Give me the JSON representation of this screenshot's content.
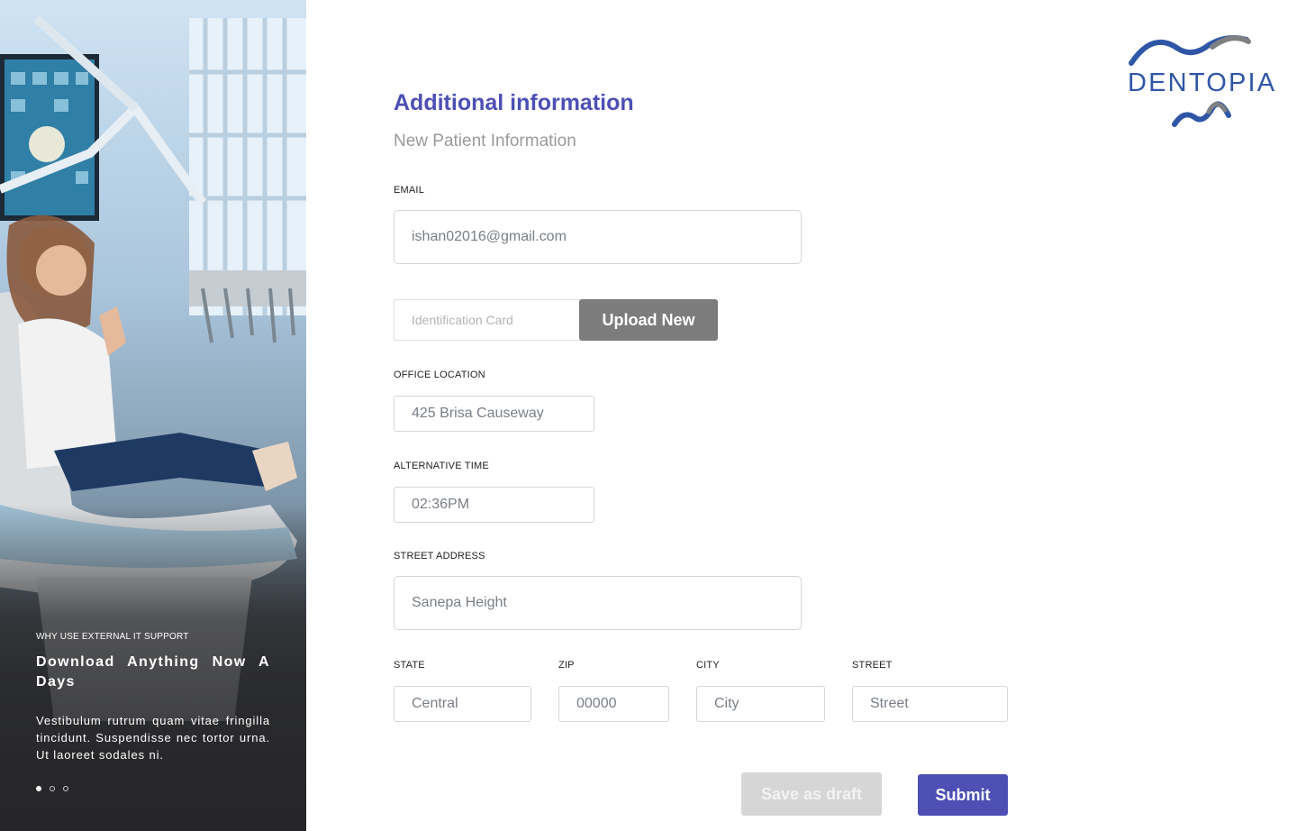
{
  "brand": {
    "name": "DENTOPIA",
    "primary_color": "#4d4fb5",
    "logo_color": "#2f56a6"
  },
  "hero": {
    "kicker": "WHY USE EXTERNAL IT SUPPORT",
    "title": "Download Anything Now A Days",
    "text": "Vestibulum rutrum quam vitae fringilla tincidunt. Suspendisse nec tortor urna. Ut laoreet sodales ni.",
    "slides_total": 3,
    "active_slide": 1
  },
  "form": {
    "title": "Additional information",
    "subtitle": "New Patient Information",
    "email": {
      "label": "EMAIL",
      "value": "ishan02016@gmail.com"
    },
    "id_card": {
      "placeholder": "Identification Card",
      "upload_label": "Upload New"
    },
    "office_location": {
      "label": "OFFICE LOCATION",
      "value": "425 Brisa Causeway"
    },
    "alternative_time": {
      "label": "ALTERNATIVE TIME",
      "value": "02:36PM"
    },
    "street_address": {
      "label": "STREET ADDRESS",
      "value": "Sanepa Height"
    },
    "state": {
      "label": "STATE",
      "value": "Central"
    },
    "zip": {
      "label": "ZIP",
      "placeholder": "00000"
    },
    "city": {
      "label": "CITY",
      "placeholder": "City"
    },
    "street": {
      "label": "STREET",
      "placeholder": "Street"
    },
    "actions": {
      "draft_label": "Save as draft",
      "submit_label": "Submit"
    }
  }
}
